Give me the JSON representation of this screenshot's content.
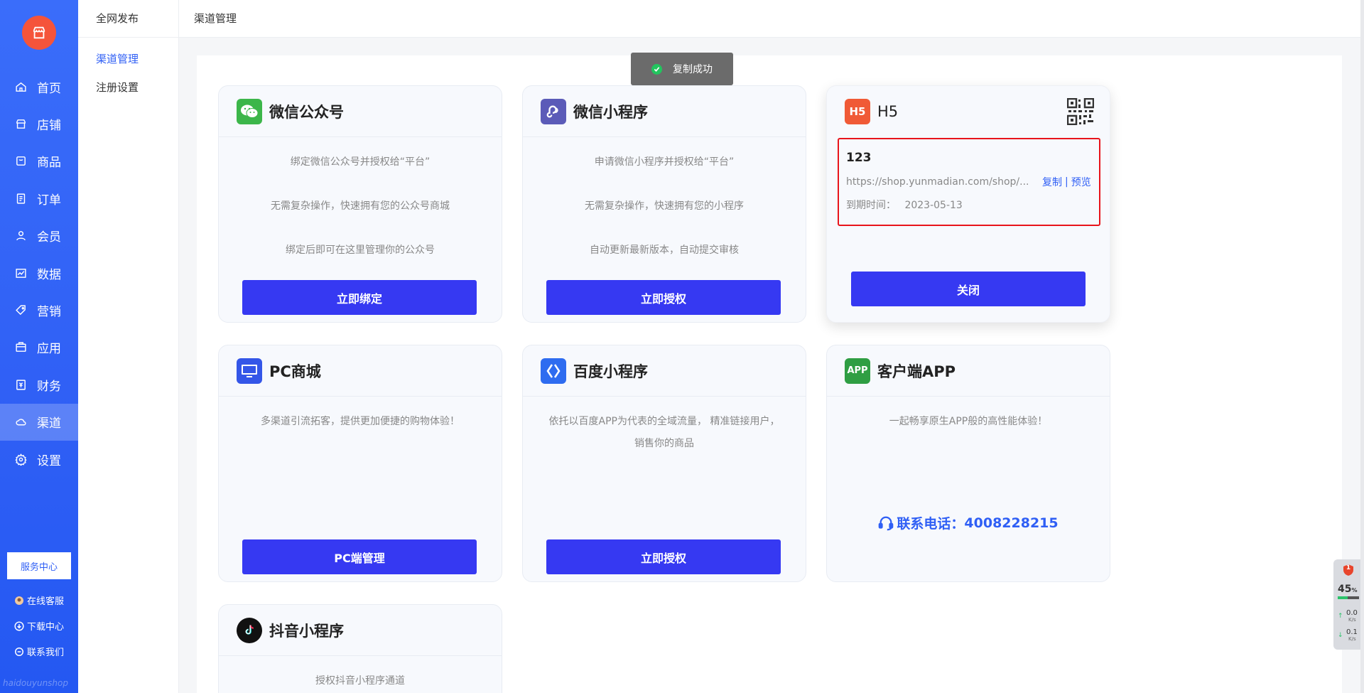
{
  "sidebar": {
    "items": [
      {
        "label": "首页",
        "icon": "home-icon"
      },
      {
        "label": "店铺",
        "icon": "store-icon"
      },
      {
        "label": "商品",
        "icon": "goods-icon"
      },
      {
        "label": "订单",
        "icon": "order-icon"
      },
      {
        "label": "会员",
        "icon": "member-icon"
      },
      {
        "label": "数据",
        "icon": "chart-icon"
      },
      {
        "label": "营销",
        "icon": "tag-icon"
      },
      {
        "label": "应用",
        "icon": "app-icon"
      },
      {
        "label": "财务",
        "icon": "finance-icon"
      },
      {
        "label": "渠道",
        "icon": "channel-icon"
      },
      {
        "label": "设置",
        "icon": "gear-icon"
      }
    ],
    "active_index": 9,
    "service_center": "服务中心",
    "online_service": "在线客服",
    "download_center": "下载中心",
    "contact_us": "联系我们",
    "watermark": "haidouyunshop"
  },
  "submenu": {
    "title": "全网发布",
    "items": [
      "渠道管理",
      "注册设置"
    ]
  },
  "header": {
    "breadcrumb": "渠道管理"
  },
  "toast": {
    "text": "复制成功"
  },
  "cards": {
    "wechat_official": {
      "title": "微信公众号",
      "lines": [
        "绑定微信公众号并授权给“平台”",
        "无需复杂操作，快速拥有您的公众号商城",
        "绑定后即可在这里管理你的公众号"
      ],
      "button": "立即绑定"
    },
    "wechat_mini": {
      "title": "微信小程序",
      "lines": [
        "申请微信小程序并授权给“平台”",
        "无需复杂操作，快速拥有您的小程序",
        "自动更新最新版本，自动提交审核"
      ],
      "button": "立即授权"
    },
    "h5": {
      "title": "H5",
      "icon_text": "H5",
      "name": "123",
      "url": "https://shop.yunmadian.com/shop/...",
      "copy": "复制",
      "separator": "|",
      "preview": "预览",
      "expire_label": "到期时间：",
      "expire_date": "2023-05-13",
      "button": "关闭"
    },
    "pc": {
      "title": "PC商城",
      "lines": [
        "多渠道引流拓客，提供更加便捷的购物体验！"
      ],
      "button": "PC端管理"
    },
    "baidu": {
      "title": "百度小程序",
      "lines": [
        "依托以百度APP为代表的全域流量， 精准链接用户，",
        "销售你的商品"
      ],
      "button": "立即授权"
    },
    "app": {
      "title": "客户端APP",
      "icon_text": "APP",
      "lines": [
        "一起畅享原生APP般的高性能体验！"
      ],
      "contact_label": "联系电话：",
      "contact_phone": "4008228215"
    },
    "douyin": {
      "title": "抖音小程序",
      "lines": [
        "授权抖音小程序通道"
      ]
    }
  },
  "monitor": {
    "badge": "1",
    "percent": "45",
    "percent_unit": "%",
    "up_speed": "0.0",
    "down_speed": "0.1",
    "speed_unit": "K/s"
  },
  "colors": {
    "primary": "#3639f2",
    "sidebar": "#2f5ff5",
    "logo": "#f5543a",
    "highlight_border": "#e8141b"
  }
}
